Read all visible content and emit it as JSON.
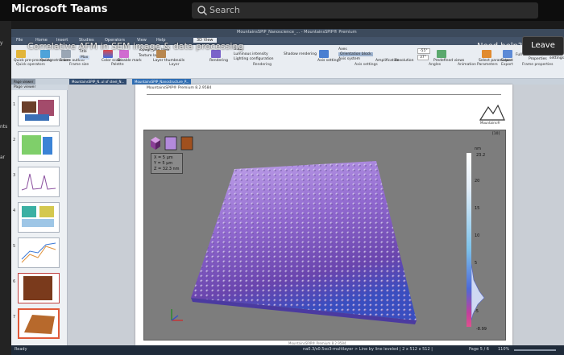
{
  "teams": {
    "app_name": "Microsoft Teams",
    "search_placeholder": "Search",
    "rail_labels": [
      "y",
      "nts",
      "ar"
    ]
  },
  "meeting": {
    "title": "Correlative AFM in SEM image & data processing",
    "need_help": "Need help?",
    "leave_label": "Leave"
  },
  "app": {
    "window_title": "MountainsSPIP_Nanoscience_... - MountainsSPIP® Premium",
    "ribbon_tabs": [
      "File",
      "Home",
      "Insert",
      "Studies",
      "Operators",
      "View",
      "Help",
      "3D View"
    ],
    "ribbon_groups": [
      {
        "name": "Quick operators"
      },
      {
        "name": "Frame size"
      },
      {
        "name": "Palette"
      },
      {
        "name": "Layer"
      },
      {
        "name": "Rendering"
      },
      {
        "name": "Axis settings"
      },
      {
        "name": "Angles"
      },
      {
        "name": "Animation"
      },
      {
        "name": "Parameters"
      },
      {
        "name": "Export"
      },
      {
        "name": "Frame properties"
      }
    ],
    "ribbon_items": [
      "Quick pre-processing",
      "Quick extraction",
      "Frame outline",
      "Title",
      "Max",
      "Color scale",
      "Disable mark",
      "Topography layer",
      "Texture layer",
      "Layer thumbnails",
      "Rendering",
      "Gloss",
      "Luminous intensity",
      "Lighting configuration",
      "Shadow rendering",
      "Axis settings",
      "Axes",
      "Orientation block",
      "Axis system",
      "Amplification",
      "Resolution",
      "Predefined views",
      "Select parameters",
      "Export",
      "Full screen",
      "Palette",
      "Hidden",
      "Properties",
      "Source settings"
    ],
    "angle_values": [
      "-55°",
      "37°"
    ],
    "doc_tabs": [
      "Page viewer",
      "MountainsSPIP_N..ul of steel_N...",
      "MountainsSPIP_Nanostructure_P..."
    ],
    "pages_header": "Page viewer",
    "page_numbers": [
      "1",
      "2",
      "3",
      "4",
      "5",
      "6",
      "7"
    ],
    "page_header_text": "MountainsSPIP® Premium 8.2.9584",
    "logo_text": "Mountains®",
    "plot_corner_label": "[10]",
    "info": [
      "X = 5 µm",
      "Y = 5 µm",
      "Z = 32.3 nm"
    ],
    "colorbar": {
      "unit": "nm",
      "max": "23.2",
      "ticks": [
        "20",
        "15",
        "10",
        "5",
        "0",
        "-5"
      ],
      "min": "-8.99"
    },
    "footer_text": "MountainsSPIP® Premium 8.2.9584",
    "status_ready": "Ready",
    "status_layer": "na0.3/s0.5so3-multilayer > Line by line leveled | 2 x 512 x 512 |",
    "status_page": "Page 5 / 6",
    "status_zoom": "110%"
  },
  "colors": {
    "surface_top": "#b79ae0",
    "surface_mid": "#8a66c9",
    "surface_low": "#3d4fbf",
    "colorbar_top": "#ffffff",
    "colorbar_bottom": "#e0508e"
  }
}
